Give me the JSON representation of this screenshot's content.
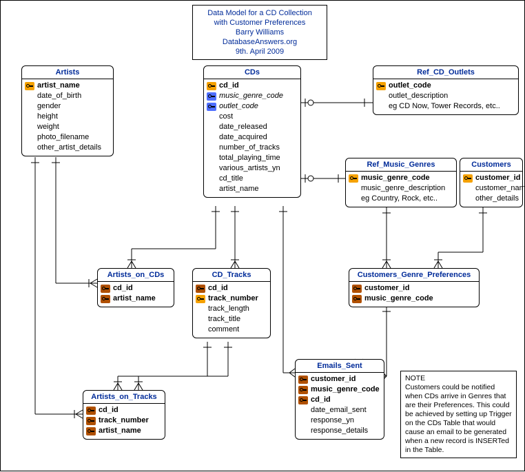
{
  "title_box": {
    "line1": "Data Model for a CD Collection",
    "line2": "with Customer Preferences",
    "line3": "Barry Williams",
    "line4": "DatabaseAnswers.org",
    "line5": "9th. April 2009"
  },
  "note_box": {
    "heading": "NOTE",
    "body": "Customers could be notified when CDs arrive in Genres that are their Preferences. This could be achieved by setting up Trigger on the CDs Table that would cause an email to be generated when a new record is INSERTed in the Table."
  },
  "entities": {
    "artists": {
      "title": "Artists",
      "fields": [
        {
          "key": "pk",
          "name": "artist_name",
          "bold": true
        },
        {
          "key": "",
          "name": "date_of_birth"
        },
        {
          "key": "",
          "name": "gender"
        },
        {
          "key": "",
          "name": "height"
        },
        {
          "key": "",
          "name": "weight"
        },
        {
          "key": "",
          "name": "photo_filename"
        },
        {
          "key": "",
          "name": "other_artist_details"
        }
      ]
    },
    "cds": {
      "title": "CDs",
      "fields": [
        {
          "key": "pk",
          "name": "cd_id",
          "bold": true
        },
        {
          "key": "fk",
          "name": "music_genre_code",
          "italic": true
        },
        {
          "key": "fk",
          "name": "outlet_code",
          "italic": true
        },
        {
          "key": "",
          "name": "cost"
        },
        {
          "key": "",
          "name": "date_released"
        },
        {
          "key": "",
          "name": "date_acquired"
        },
        {
          "key": "",
          "name": "number_of_tracks"
        },
        {
          "key": "",
          "name": "total_playing_time"
        },
        {
          "key": "",
          "name": "various_artists_yn"
        },
        {
          "key": "",
          "name": "cd_title"
        },
        {
          "key": "",
          "name": "artist_name"
        }
      ]
    },
    "outlets": {
      "title": "Ref_CD_Outlets",
      "fields": [
        {
          "key": "pk",
          "name": "outlet_code",
          "bold": true
        },
        {
          "key": "",
          "name": "outlet_description"
        },
        {
          "key": "",
          "name": "eg CD Now, Tower Records, etc.."
        }
      ]
    },
    "genres": {
      "title": "Ref_Music_Genres",
      "fields": [
        {
          "key": "pk",
          "name": "music_genre_code",
          "bold": true
        },
        {
          "key": "",
          "name": "music_genre_description"
        },
        {
          "key": "",
          "name": "eg Country, Rock, etc.."
        }
      ]
    },
    "customers": {
      "title": "Customers",
      "fields": [
        {
          "key": "pk",
          "name": "customer_id",
          "bold": true
        },
        {
          "key": "",
          "name": "customer_name"
        },
        {
          "key": "",
          "name": "other_details"
        }
      ]
    },
    "artists_on_cds": {
      "title": "Artists_on_CDs",
      "fields": [
        {
          "key": "pf",
          "name": "cd_id",
          "bold": true
        },
        {
          "key": "pf",
          "name": "artist_name",
          "bold": true
        }
      ]
    },
    "cd_tracks": {
      "title": "CD_Tracks",
      "fields": [
        {
          "key": "pf",
          "name": "cd_id",
          "bold": true
        },
        {
          "key": "pk",
          "name": "track_number",
          "bold": true
        },
        {
          "key": "",
          "name": "track_length"
        },
        {
          "key": "",
          "name": "track_title"
        },
        {
          "key": "",
          "name": "comment"
        }
      ]
    },
    "emails_sent": {
      "title": "Emails_Sent",
      "fields": [
        {
          "key": "pf",
          "name": "customer_id",
          "bold": true
        },
        {
          "key": "pf",
          "name": "music_genre_code",
          "bold": true
        },
        {
          "key": "pf",
          "name": "cd_id",
          "bold": true
        },
        {
          "key": "",
          "name": "date_email_sent"
        },
        {
          "key": "",
          "name": "response_yn"
        },
        {
          "key": "",
          "name": "response_details"
        }
      ]
    },
    "cust_genre_prefs": {
      "title": "Customers_Genre_Preferences",
      "fields": [
        {
          "key": "pf",
          "name": "customer_id",
          "bold": true
        },
        {
          "key": "pf",
          "name": "music_genre_code",
          "bold": true
        }
      ]
    },
    "artists_on_tracks": {
      "title": "Artists_on_Tracks",
      "fields": [
        {
          "key": "pf",
          "name": "cd_id",
          "bold": true
        },
        {
          "key": "pf",
          "name": "track_number",
          "bold": true
        },
        {
          "key": "pf",
          "name": "artist_name",
          "bold": true
        }
      ]
    }
  }
}
